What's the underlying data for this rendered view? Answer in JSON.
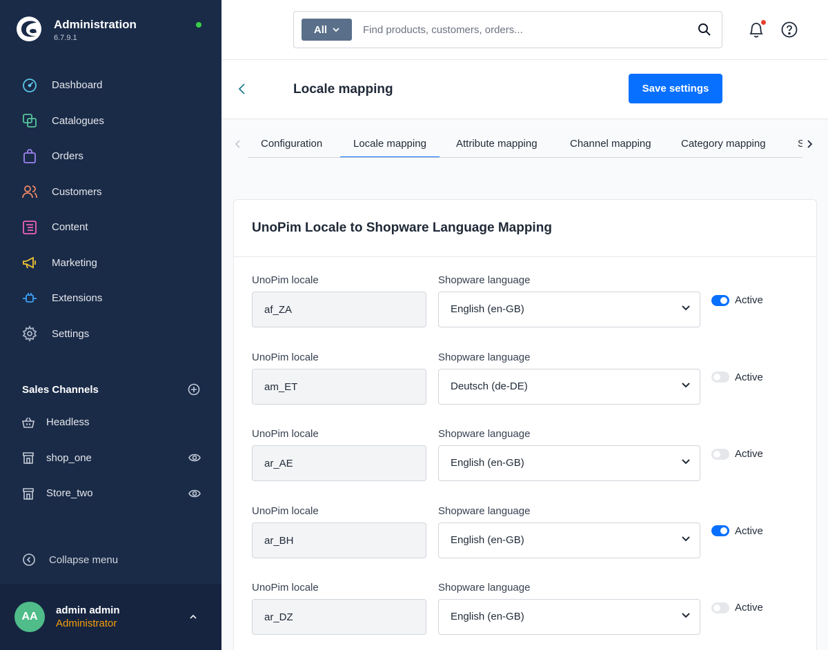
{
  "app": {
    "title": "Administration",
    "version": "6.7.9.1"
  },
  "nav": {
    "items": [
      {
        "label": "Dashboard",
        "icon": "gauge-icon",
        "color": "#5cc6e6"
      },
      {
        "label": "Catalogues",
        "icon": "catalog-icon",
        "color": "#56c59b"
      },
      {
        "label": "Orders",
        "icon": "shopping-bag-icon",
        "color": "#a084f0"
      },
      {
        "label": "Customers",
        "icon": "users-icon",
        "color": "#f08a68"
      },
      {
        "label": "Content",
        "icon": "content-icon",
        "color": "#ef62b8"
      },
      {
        "label": "Marketing",
        "icon": "megaphone-icon",
        "color": "#f4c634"
      },
      {
        "label": "Extensions",
        "icon": "plug-icon",
        "color": "#3ba3f7"
      },
      {
        "label": "Settings",
        "icon": "gear-icon",
        "color": "#aab4c4"
      }
    ]
  },
  "sales_channels": {
    "title": "Sales Channels",
    "items": [
      {
        "label": "Headless",
        "icon": "basket-icon"
      },
      {
        "label": "shop_one",
        "icon": "storefront-icon"
      },
      {
        "label": "Store_two",
        "icon": "storefront-icon"
      }
    ]
  },
  "collapse_label": "Collapse menu",
  "user": {
    "initials": "AA",
    "name": "admin admin",
    "role": "Administrator"
  },
  "search": {
    "scope": "All",
    "placeholder": "Find products, customers, orders..."
  },
  "page": {
    "title": "Locale mapping",
    "save_label": "Save settings"
  },
  "tabs": [
    {
      "label": "Configuration",
      "active": false
    },
    {
      "label": "Locale mapping",
      "active": true
    },
    {
      "label": "Attribute mapping",
      "active": false
    },
    {
      "label": "Channel mapping",
      "active": false
    },
    {
      "label": "Category mapping",
      "active": false
    },
    {
      "label": "S",
      "active": false
    }
  ],
  "card": {
    "title": "UnoPim Locale to Shopware Language Mapping",
    "locale_label": "UnoPim locale",
    "language_label": "Shopware language",
    "active_label": "Active",
    "rows": [
      {
        "locale": "af_ZA",
        "language": "English (en-GB)",
        "active": true
      },
      {
        "locale": "am_ET",
        "language": "Deutsch (de-DE)",
        "active": false
      },
      {
        "locale": "ar_AE",
        "language": "English (en-GB)",
        "active": false
      },
      {
        "locale": "ar_BH",
        "language": "English (en-GB)",
        "active": true
      },
      {
        "locale": "ar_DZ",
        "language": "English (en-GB)",
        "active": false
      }
    ]
  },
  "colors": {
    "sidebar": "#1a2b48",
    "accent": "#0870ff",
    "status_online": "#37d046",
    "role": "#f59e0b",
    "avatar": "#4fbc8a"
  }
}
